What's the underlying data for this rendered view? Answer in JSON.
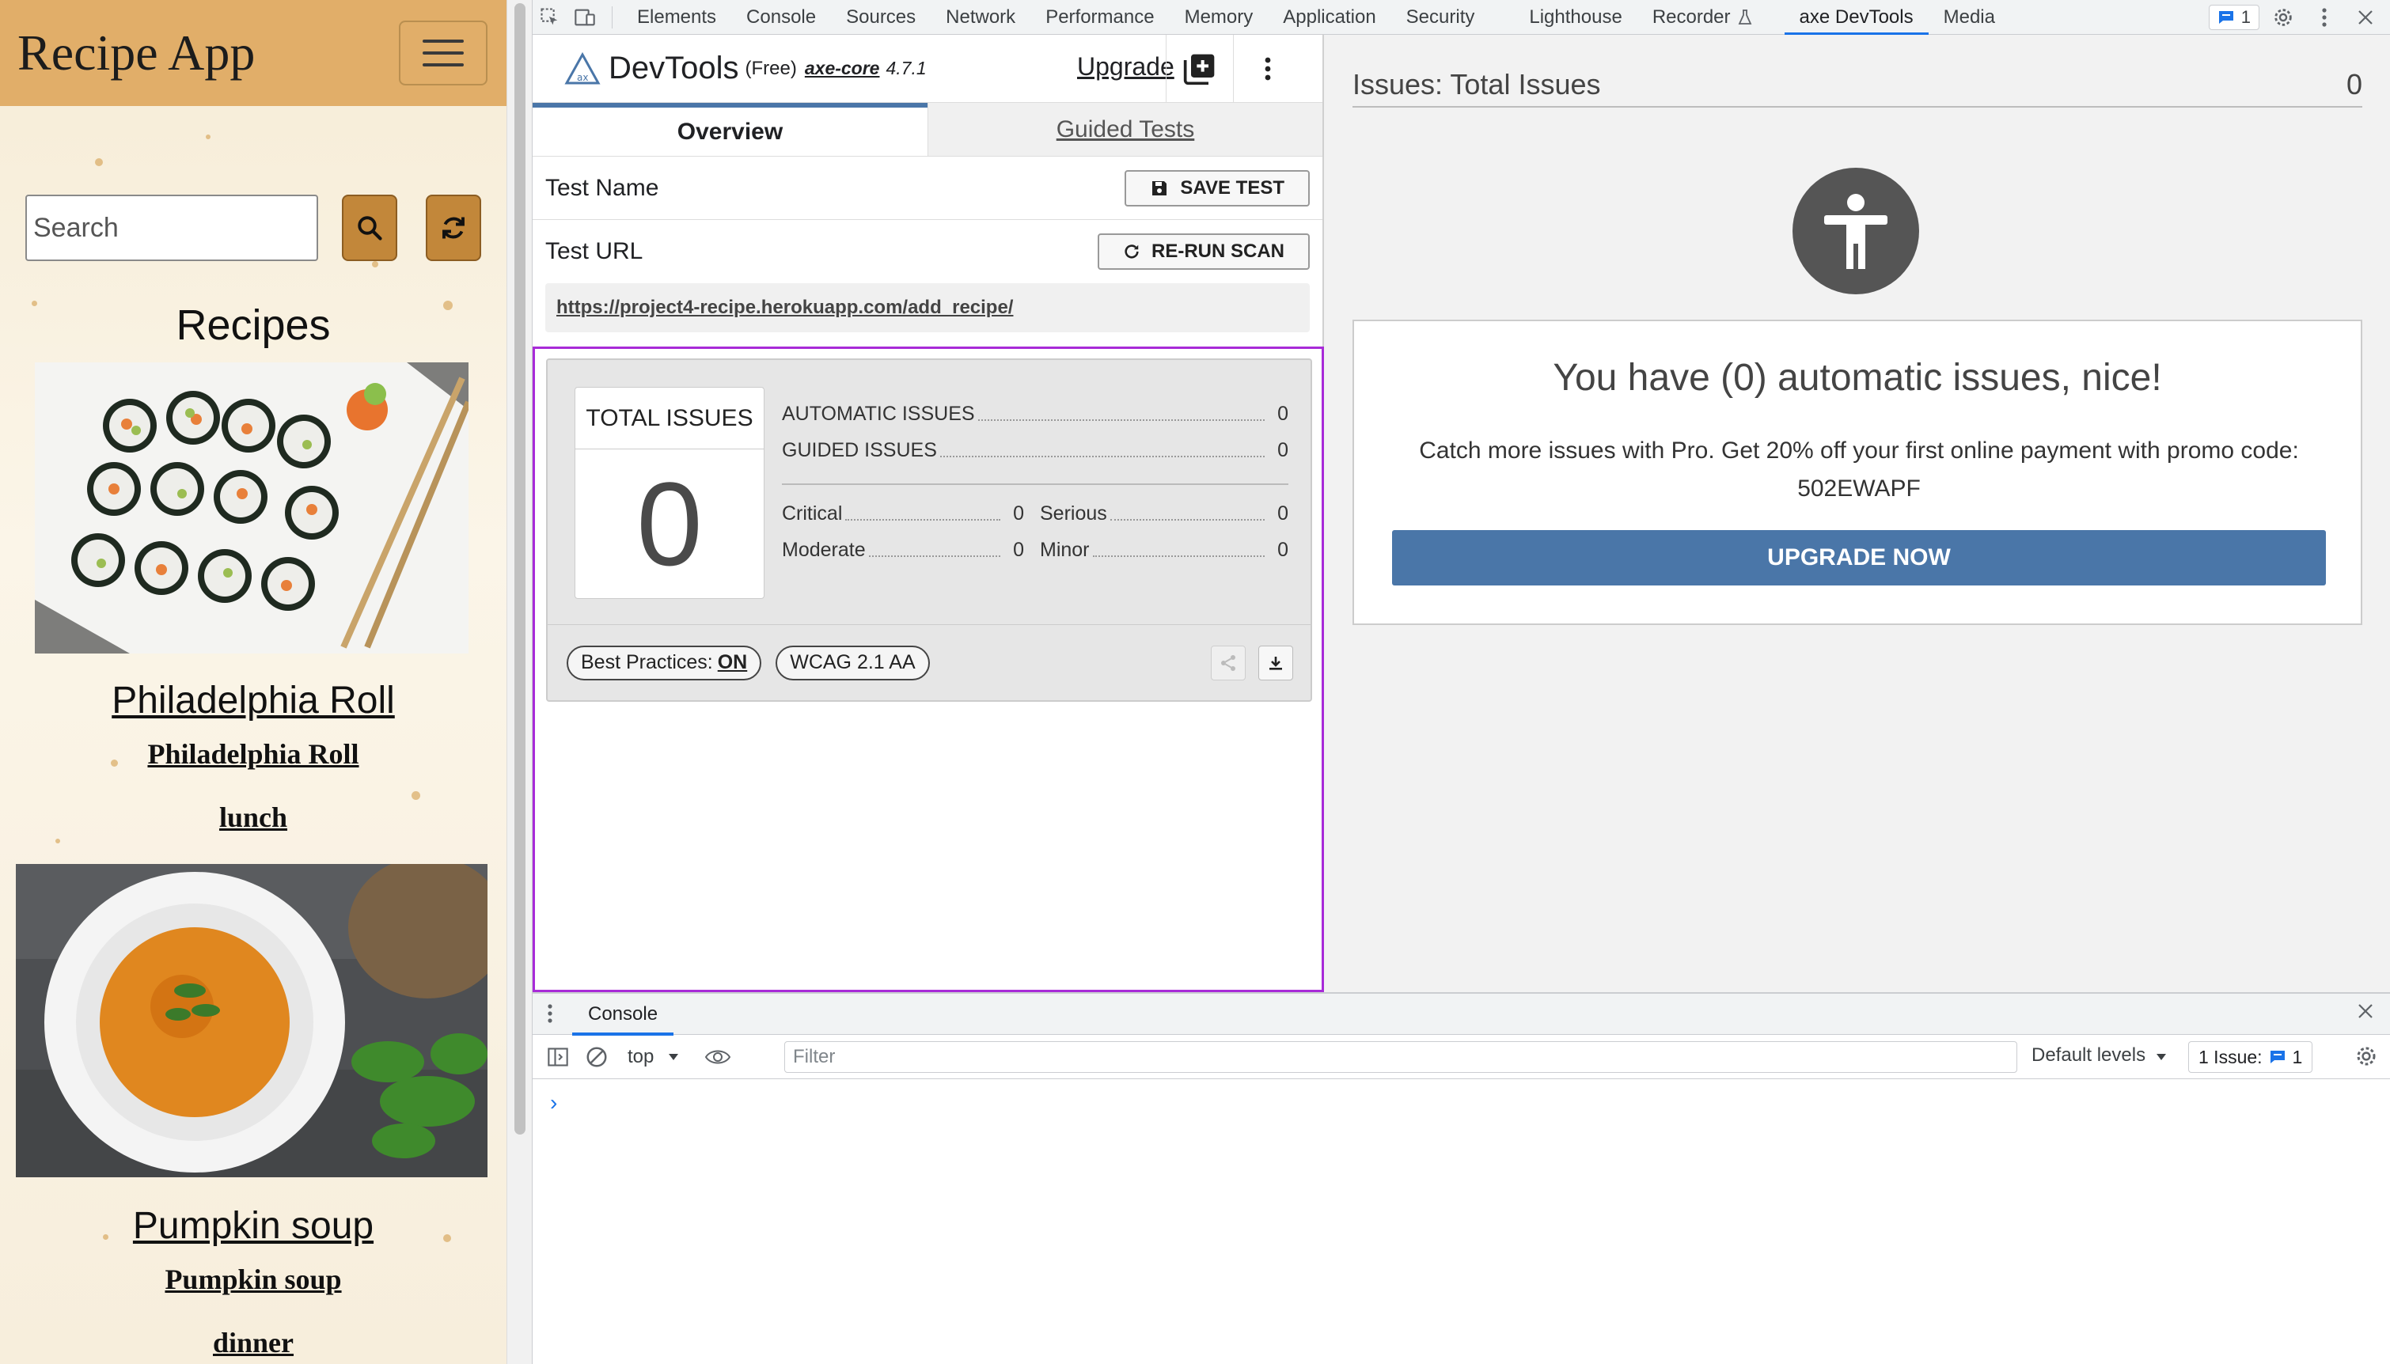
{
  "app": {
    "title": "Recipe App",
    "search_placeholder": "Search",
    "recipes_heading": "Recipes",
    "recipes": [
      {
        "title": "Philadelphia Roll",
        "subtitle": "Philadelphia Roll",
        "meal": "lunch"
      },
      {
        "title": "Pumpkin soup",
        "subtitle": "Pumpkin soup",
        "meal": "dinner"
      }
    ]
  },
  "devtools": {
    "tabs": [
      {
        "label": "Elements"
      },
      {
        "label": "Console"
      },
      {
        "label": "Sources"
      },
      {
        "label": "Network"
      },
      {
        "label": "Performance"
      },
      {
        "label": "Memory"
      },
      {
        "label": "Application"
      },
      {
        "label": "Security"
      },
      {
        "label": "Lighthouse"
      },
      {
        "label": "Recorder"
      },
      {
        "label": "axe DevTools"
      },
      {
        "label": "Media"
      }
    ],
    "issues_badge_count": "1",
    "accent": "#1a73e8"
  },
  "axe": {
    "brand": "DevTools",
    "tier": "(Free)",
    "engine": "axe-core",
    "version": "4.7.1",
    "upgrade_link": "Upgrade",
    "tabs": {
      "overview": "Overview",
      "guided": "Guided Tests"
    },
    "test_name_label": "Test Name",
    "save_test": "SAVE TEST",
    "test_url_label": "Test URL",
    "rerun_scan": "RE-RUN SCAN",
    "test_url": "https://project4-recipe.herokuapp.com/add_recipe/",
    "summary": {
      "total_label": "TOTAL ISSUES",
      "total": "0",
      "automatic_label": "AUTOMATIC ISSUES",
      "automatic": "0",
      "guided_label": "GUIDED ISSUES",
      "guided": "0",
      "critical_label": "Critical",
      "critical": "0",
      "serious_label": "Serious",
      "serious": "0",
      "moderate_label": "Moderate",
      "moderate": "0",
      "minor_label": "Minor",
      "minor": "0"
    },
    "best_practices_label": "Best Practices:",
    "best_practices_value": "ON",
    "standard": "WCAG 2.1 AA",
    "issues_header": "Issues: Total Issues",
    "issues_count": "0",
    "nice_title": "You have (0) automatic issues, nice!",
    "promo_text": "Catch more issues with Pro. Get 20% off your first online payment with promo code: 502EWAPF",
    "upgrade_now": "UPGRADE NOW",
    "accent": "#4a76a8"
  },
  "console": {
    "tab_label": "Console",
    "context": "top",
    "filter_placeholder": "Filter",
    "levels": "Default levels",
    "issues_label": "1 Issue:",
    "issues_count": "1",
    "prompt": "›"
  }
}
